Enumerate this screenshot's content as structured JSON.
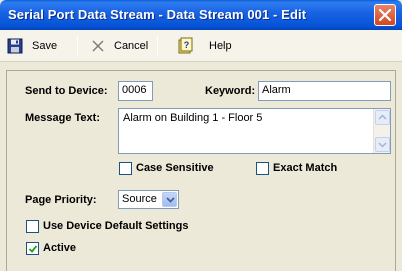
{
  "window": {
    "title": "Serial Port Data Stream - Data Stream 001 - Edit"
  },
  "toolbar": {
    "save_label": "Save",
    "cancel_label": "Cancel",
    "help_label": "Help"
  },
  "form": {
    "send_to_device_label": "Send to Device:",
    "send_to_device_value": "0006",
    "keyword_label": "Keyword:",
    "keyword_value": "Alarm",
    "message_text_label": "Message Text:",
    "message_text_value": "Alarm on Building 1 - Floor 5",
    "case_sensitive_label": "Case Sensitive",
    "case_sensitive_checked": false,
    "exact_match_label": "Exact Match",
    "exact_match_checked": false,
    "page_priority_label": "Page Priority:",
    "page_priority_value": "Source",
    "use_device_default_label": "Use Device Default Settings",
    "use_device_default_checked": false,
    "active_label": "Active",
    "active_checked": true
  },
  "colors": {
    "titlebar": "#0553D6",
    "close_button": "#D3451E",
    "background": "#ECE9D8"
  }
}
